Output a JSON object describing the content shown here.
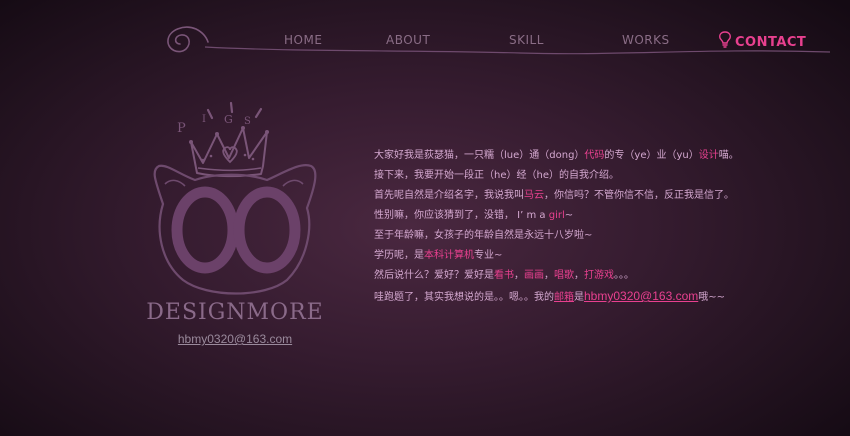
{
  "nav": {
    "items": [
      {
        "label": "HOME",
        "active": false
      },
      {
        "label": "ABOUT",
        "active": false
      },
      {
        "label": "SKILL",
        "active": false
      },
      {
        "label": "WORKS",
        "active": false
      },
      {
        "label": "CONTACT",
        "active": true
      }
    ]
  },
  "logo": {
    "crown_letters": [
      "P",
      "I",
      "G",
      "S"
    ],
    "brand": "DESIGNMORE",
    "email": "hbmy0320@163.com"
  },
  "intro": {
    "lines": [
      {
        "parts": [
          {
            "text": "大家好我是荻瑟猫，一只糯（lue）通（dong）",
            "hl": false
          },
          {
            "text": "代码",
            "hl": true
          },
          {
            "text": "的专（ye）业（yu）",
            "hl": false
          },
          {
            "text": "设计",
            "hl": true
          },
          {
            "text": "喵。",
            "hl": false
          }
        ]
      },
      {
        "parts": [
          {
            "text": "接下来，我要开始一段正（he）经（he）的自我介绍。",
            "hl": false
          }
        ]
      },
      {
        "parts": [
          {
            "text": "首先呢自然是介绍名字，我说我叫",
            "hl": false
          },
          {
            "text": "马云",
            "hl": true
          },
          {
            "text": "，你信吗？不管你信不信，反正我是信了。",
            "hl": false
          }
        ]
      },
      {
        "parts": [
          {
            "text": "性别嘛，你应该猜到了，没错，  I’ m a ",
            "hl": false
          },
          {
            "text": "girl",
            "hl": true
          },
          {
            "text": "~",
            "hl": false
          }
        ]
      },
      {
        "parts": [
          {
            "text": "至于年龄嘛，女孩子的年龄自然是永远十八岁啦~",
            "hl": false
          }
        ]
      },
      {
        "parts": [
          {
            "text": "学历呢，是",
            "hl": false
          },
          {
            "text": "本科计算机",
            "hl": true
          },
          {
            "text": "专业~",
            "hl": false
          }
        ]
      },
      {
        "parts": [
          {
            "text": "然后说什么？爱好？爱好是",
            "hl": false
          },
          {
            "text": "看书",
            "hl": true
          },
          {
            "text": "，",
            "hl": false
          },
          {
            "text": "画画",
            "hl": true
          },
          {
            "text": "，",
            "hl": false
          },
          {
            "text": "唱歌",
            "hl": true
          },
          {
            "text": "，",
            "hl": false
          },
          {
            "text": "打游戏",
            "hl": true
          },
          {
            "text": "。。。",
            "hl": false
          }
        ]
      },
      {
        "parts": [
          {
            "text": "哇跑题了，其实我想说的是。。嗯。。我的",
            "hl": false
          },
          {
            "text": "邮箱",
            "hl": true,
            "link": true
          },
          {
            "text": "是",
            "hl": false
          },
          {
            "text": "hbmy0320@163.com",
            "hl": true,
            "link": true,
            "mail": true
          },
          {
            "text": "哦~~",
            "hl": false
          }
        ]
      }
    ]
  },
  "colors": {
    "accent": "#e8408f",
    "nav_text": "#8a6d86",
    "body_text": "#d4a8d0",
    "logo_stroke": "#6e4a6d",
    "background": "#361c30"
  },
  "icons": {
    "nav_swirl": "swirl-icon",
    "contact": "lightbulb-icon"
  }
}
